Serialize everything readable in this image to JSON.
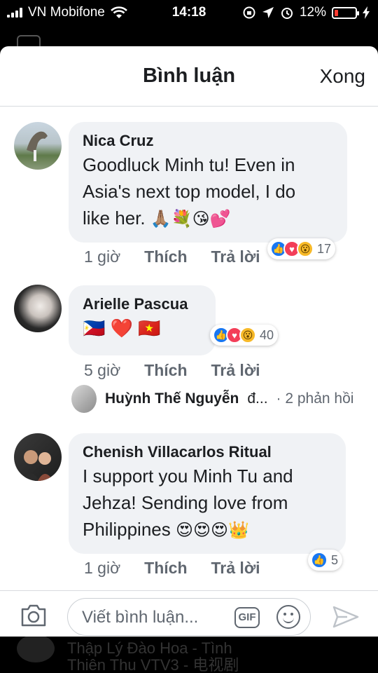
{
  "status_bar": {
    "carrier": "VN Mobifone",
    "time": "14:18",
    "battery": "12%",
    "battery_level": 0.12
  },
  "header": {
    "title": "Bình luận",
    "done": "Xong"
  },
  "comments": [
    {
      "name": "Nica Cruz",
      "lines": [
        "Goodluck Minh tu! Even in",
        "Asia's next top model, I do",
        "like her."
      ],
      "emoji": "🙏🏽💐😘💕",
      "time": "1 giờ",
      "like": "Thích",
      "reply": "Trả lời",
      "reaction_count": "17"
    },
    {
      "name": "Arielle Pascua",
      "emoji": "🇵🇭 ❤️ 🇻🇳",
      "time": "5 giờ",
      "like": "Thích",
      "reply": "Trả lời",
      "reaction_count": "40",
      "reply_preview": {
        "name": "Huỳnh Thế Nguyễn",
        "ellipsis": "đ...",
        "count": "· 2 phản hồi"
      }
    },
    {
      "name": "Chenish Villacarlos Ritual",
      "lines": [
        "I support you Minh Tu and",
        "Jehza! Sending love from",
        "Philippines"
      ],
      "emoji": "😍😍😍👑",
      "time": "1 giờ",
      "like": "Thích",
      "reply": "Trả lời",
      "reaction_count": "5"
    }
  ],
  "composer": {
    "placeholder": "Viết bình luận...",
    "gif_label": "GIF"
  },
  "background": {
    "text_line1": "Thập Lý Đào Hoa - Tình",
    "text_line2": "Thiên Thu VTV3 - 电视剧"
  },
  "icons": {
    "camera": "camera-icon",
    "send": "send-icon",
    "smiley": "smiley-icon",
    "wifi": "wifi-icon"
  },
  "colors": {
    "like_blue": "#1877f2",
    "love_red": "#f33e58",
    "wow_yellow": "#f7b928",
    "bubble": "#f0f2f5",
    "battery_red": "#ff3b30"
  }
}
